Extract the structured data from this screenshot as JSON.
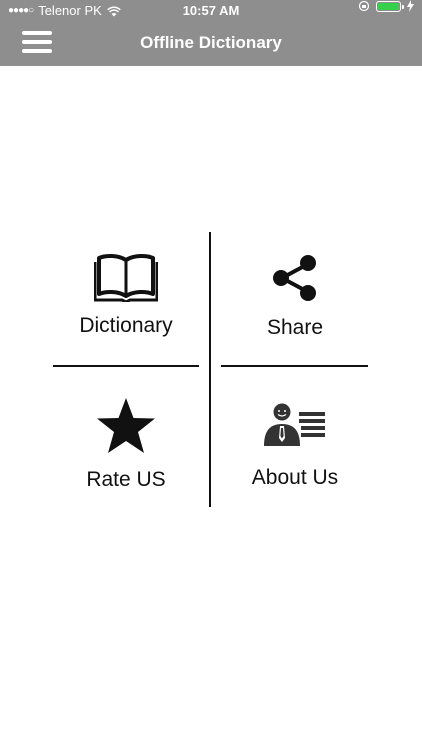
{
  "status_bar": {
    "carrier": "Telenor PK",
    "time": "10:57 AM"
  },
  "header": {
    "title": "Offline Dictionary"
  },
  "menu": [
    {
      "label": "Dictionary",
      "icon": "book-icon"
    },
    {
      "label": "Share",
      "icon": "share-icon"
    },
    {
      "label": "Rate US",
      "icon": "star-icon"
    },
    {
      "label": "About Us",
      "icon": "about-person-icon"
    }
  ],
  "colors": {
    "header_bg": "#8e8e8e",
    "battery": "#35d14b"
  }
}
